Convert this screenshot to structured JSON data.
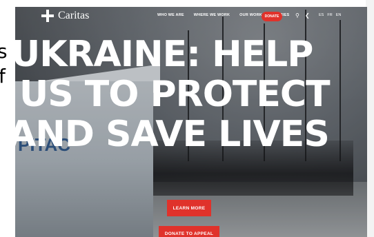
{
  "background_fragments": [
    "s",
    "f"
  ],
  "nav": {
    "logo_text": "Caritas",
    "links": [
      "WHO WE ARE",
      "WHERE WE WORK",
      "OUR WORK",
      "STORIES"
    ],
    "donate_label": "DONATE",
    "search_icon": "search-icon",
    "share_icon": "share-icon",
    "languages": [
      "ES",
      "FR",
      "EN"
    ]
  },
  "hero": {
    "headline_lines": [
      "UKRAINE: HELP",
      "US TO PROTECT",
      "AND SAVE LIVES"
    ],
    "tent_text": "PITAC",
    "learn_more_label": "LEARN MORE",
    "donate_appeal_label": "DONATE TO APPEAL"
  },
  "colors": {
    "accent": "#e0322b"
  }
}
